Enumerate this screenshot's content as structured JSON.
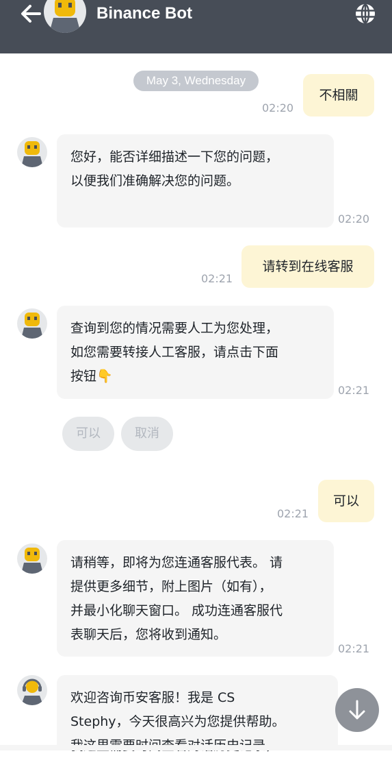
{
  "header": {
    "title": "Binance Bot",
    "back_icon": "arrow-left-icon",
    "menu_icon": "globe-icon",
    "bg_color": "#474d57"
  },
  "chat": {
    "date_separator": "May 3, Wednesday",
    "messages": [
      {
        "from": "user",
        "text": "不相關",
        "time": "02:20"
      },
      {
        "from": "bot",
        "lines": [
          "您好，能否详细描述一下您的问题，",
          "以便我们准确解决您的问题。"
        ],
        "time": "02:20"
      },
      {
        "from": "user",
        "text": "请转到在线客服",
        "time": "02:21"
      },
      {
        "from": "bot",
        "lines": [
          "查询到您的情况需要人工为您处理，",
          "如您需要转接人工客服，请点击下面",
          "按钮👇"
        ],
        "time": "02:21"
      },
      {
        "from": "user",
        "text": "可以",
        "time": "02:21"
      },
      {
        "from": "bot",
        "lines": [
          "请稍等，即将为您连通客服代表。 请",
          "提供更多细节，附上图片（如有），",
          "并最小化聊天窗口。 成功连通客服代",
          "表聊天后，您将收到通知。"
        ],
        "time": "02:21"
      },
      {
        "from": "agent",
        "lines": [
          "欢迎咨询币安客服！我是 CS",
          "Stephy，今天很高兴为您提供帮助。",
          "我这里需要时间查看对话历史记录，"
        ]
      }
    ],
    "quick_replies": [
      "可以",
      "取消"
    ]
  },
  "scroll_button_icon": "arrow-down-icon",
  "colors": {
    "user_bubble": "#fdf5d5",
    "bot_bubble": "#f5f5f5",
    "time_text": "#9ea4ae",
    "bot_avatar_accent": "#f0b90b"
  }
}
